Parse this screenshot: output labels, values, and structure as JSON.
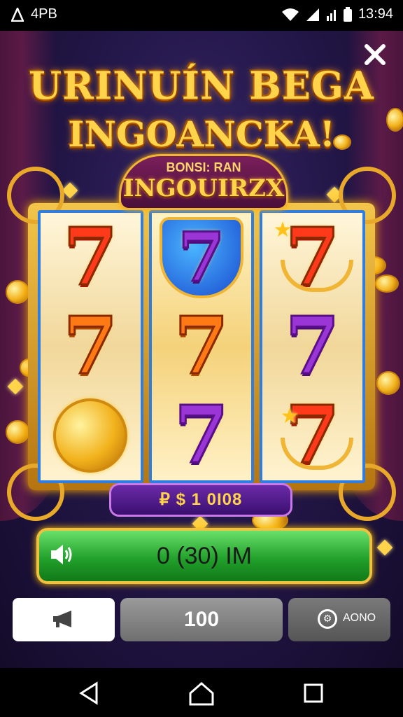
{
  "status_bar": {
    "left_label": "4PB",
    "time": "13:94"
  },
  "title": {
    "line1": "URINUÍN BEGA",
    "line2": "INGOANCKA!"
  },
  "plaque": {
    "sub": "BONSI: RAN",
    "main": "INGOUIRZX"
  },
  "reels": [
    {
      "symbols": [
        "red-seven",
        "orange-seven",
        "gold-coin"
      ]
    },
    {
      "symbols": [
        "shield-purple-seven",
        "orange-seven",
        "purple-seven"
      ]
    },
    {
      "symbols": [
        "laurel-red-seven",
        "purple-seven",
        "star-red-seven"
      ]
    }
  ],
  "balance": "₽ $ 1 0I08",
  "spin_bar": "0 (30) IM",
  "controls": {
    "bet_value": "100",
    "auto_label": "AONO"
  },
  "colors": {
    "accent_gold": "#ffd34a",
    "spin_green": "#22a12c",
    "reel_border": "#2f7de0"
  }
}
